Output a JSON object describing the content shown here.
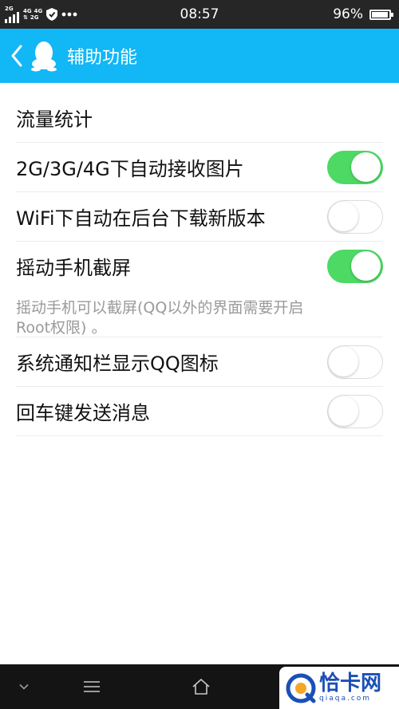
{
  "status_bar": {
    "net_top": "2G",
    "net_4g_1": "4G",
    "net_4g_2": "4G",
    "net_2g": "2G",
    "time": "08:57",
    "battery_text": "96%",
    "battery_level": 0.96,
    "more_icon": "more-dots-icon"
  },
  "title_bar": {
    "title": "辅助功能",
    "accent_color": "#12b7f5"
  },
  "section": {
    "title": "流量统计"
  },
  "settings": [
    {
      "label": "2G/3G/4G下自动接收图片",
      "on": true
    },
    {
      "label": "WiFi下自动在后台下载新版本",
      "on": false
    },
    {
      "label": "摇动手机截屏",
      "on": true
    },
    {
      "label": "系统通知栏显示QQ图标",
      "on": false
    },
    {
      "label": "回车键发送消息",
      "on": false
    }
  ],
  "note": {
    "line1": "摇动手机可以截屏(QQ以外的界面需要开启",
    "line2": "Root权限) 。"
  },
  "watermark": {
    "title": "恰卡网",
    "domain": "qiaqa.com"
  },
  "colors": {
    "toggle_on": "#4cd964",
    "toggle_off_border": "#dcdcdc",
    "status_bar_bg": "#262626"
  }
}
